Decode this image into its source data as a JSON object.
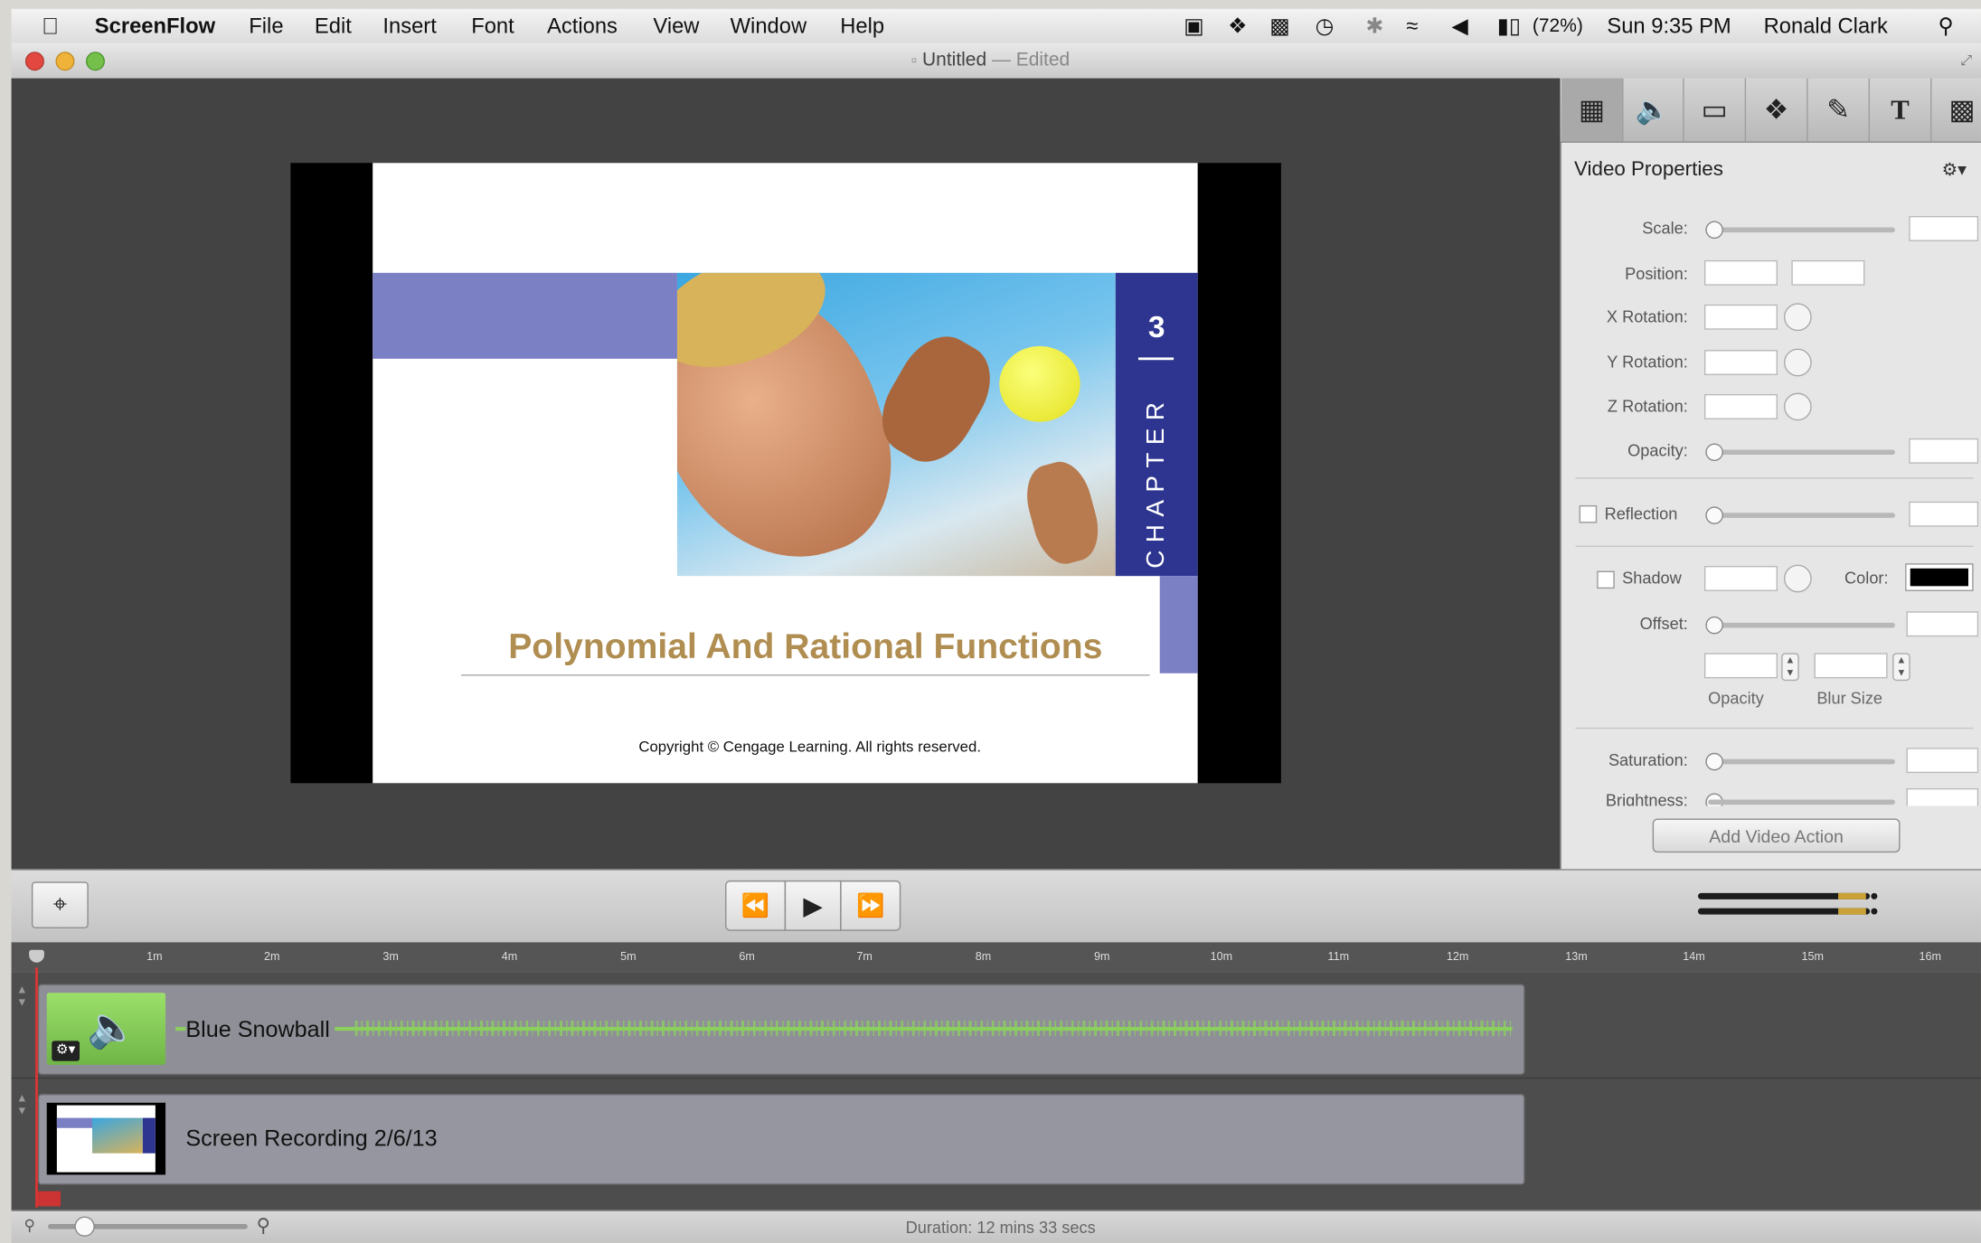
{
  "menubar": {
    "app_name": "ScreenFlow",
    "items": [
      "File",
      "Edit",
      "Insert",
      "Font",
      "Actions",
      "View",
      "Window",
      "Help"
    ],
    "battery": "(72%)",
    "clock": "Sun 9:35 PM",
    "user": "Ronald Clark"
  },
  "window": {
    "title": "Untitled",
    "title_suffix": "— Edited"
  },
  "slide": {
    "chapter_number": "3",
    "chapter_word": "CHAPTER",
    "title": "Polynomial And Rational Functions",
    "copyright": "Copyright © Cengage Learning. All rights reserved."
  },
  "inspector": {
    "heading": "Video Properties",
    "labels": {
      "scale": "Scale:",
      "position": "Position:",
      "x_rotation": "X Rotation:",
      "y_rotation": "Y Rotation:",
      "z_rotation": "Z Rotation:",
      "opacity": "Opacity:",
      "reflection": "Reflection",
      "shadow": "Shadow",
      "color": "Color:",
      "offset": "Offset:",
      "shadow_opacity": "Opacity",
      "blur_size": "Blur Size",
      "saturation": "Saturation:",
      "brightness": "Brightness:"
    },
    "add_action_button": "Add Video Action",
    "shadow_color": "#000000"
  },
  "timeline": {
    "ruler_ticks": [
      "1m",
      "2m",
      "3m",
      "4m",
      "5m",
      "6m",
      "7m",
      "8m",
      "9m",
      "10m",
      "11m",
      "12m",
      "13m",
      "14m",
      "15m",
      "16m"
    ],
    "tracks": [
      {
        "label": "Blue Snowball"
      },
      {
        "label": "Screen Recording 2/6/13"
      }
    ]
  },
  "status": {
    "duration": "Duration: 12 mins 33 secs"
  },
  "colors": {
    "accent_purple": "#7b7fc4",
    "chapter_blue": "#2d3591",
    "title_gold": "#b08d50",
    "audio_green": "#8bcf5e"
  }
}
